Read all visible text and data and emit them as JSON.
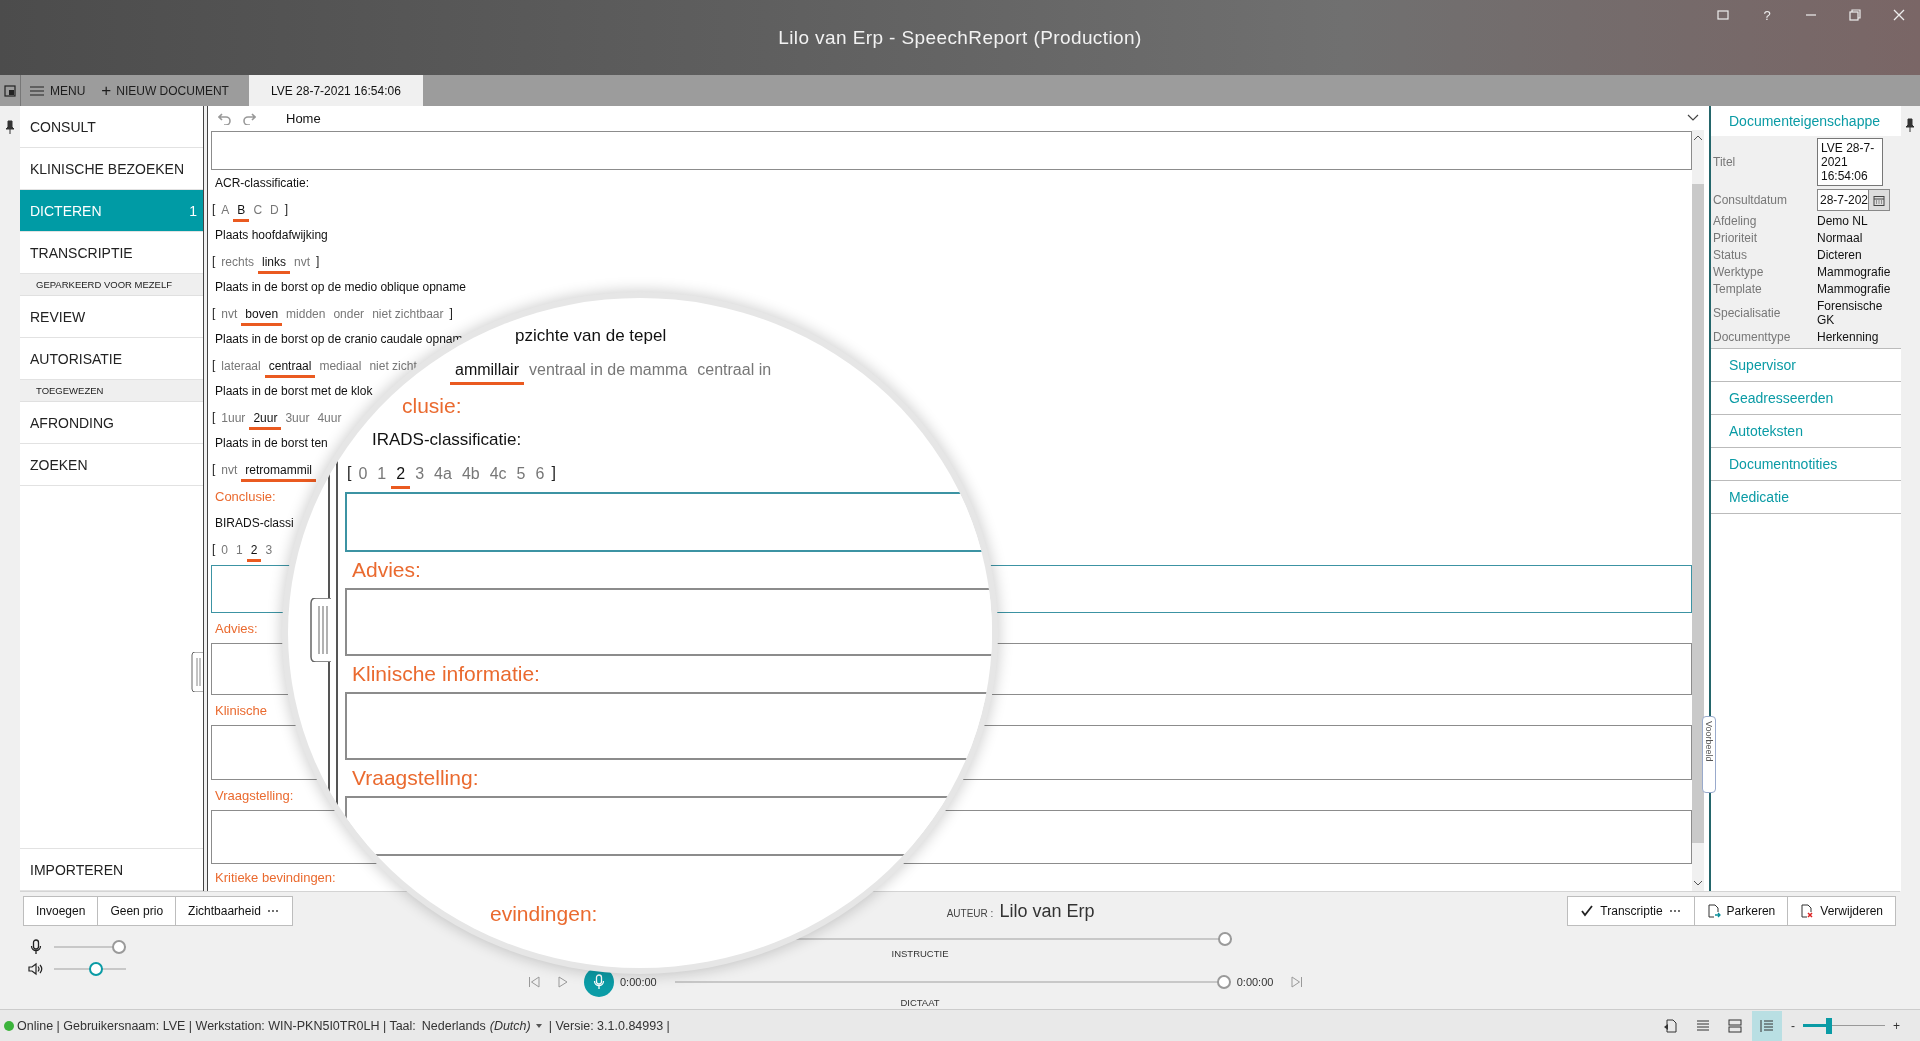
{
  "window": {
    "title": "Lilo van Erp - SpeechReport (Production)",
    "help_label": "?"
  },
  "tabbar": {
    "menu": "MENU",
    "new_document": "NIEUW DOCUMENT",
    "new_sign": "+",
    "tabs": [
      {
        "label": "LVE 28-7-2021 16:54:06",
        "selected": true
      }
    ]
  },
  "sidebar": {
    "items": [
      {
        "kind": "item",
        "label": "CONSULT",
        "selected": false
      },
      {
        "kind": "item",
        "label": "KLINISCHE BEZOEKEN",
        "selected": false
      },
      {
        "kind": "item",
        "label": "DICTEREN",
        "selected": true,
        "count": "1"
      },
      {
        "kind": "item",
        "label": "TRANSCRIPTIE",
        "selected": false
      },
      {
        "kind": "header",
        "label": "GEPARKEERD VOOR MEZELF"
      },
      {
        "kind": "item",
        "label": "REVIEW",
        "selected": false
      },
      {
        "kind": "item",
        "label": "AUTORISATIE",
        "selected": false
      },
      {
        "kind": "header",
        "label": "TOEGEWEZEN"
      },
      {
        "kind": "item",
        "label": "AFRONDING",
        "selected": false
      },
      {
        "kind": "item",
        "label": "ZOEKEN",
        "selected": false
      }
    ],
    "footer_items": [
      {
        "label": "IMPORTEREN",
        "selected": false
      }
    ]
  },
  "editor": {
    "toolbar": {
      "style": "Home"
    },
    "lines": [
      {
        "kind": "box",
        "focused": false
      },
      {
        "kind": "label",
        "text": "ACR-classificatie:"
      },
      {
        "kind": "options",
        "open": "[",
        "items": [
          {
            "label": "A",
            "selected": false
          },
          {
            "label": "B",
            "selected": true
          },
          {
            "label": "C",
            "selected": false
          },
          {
            "label": "D",
            "selected": false
          }
        ],
        "close": "]"
      },
      {
        "kind": "label",
        "text": "Plaats hoofdafwijking"
      },
      {
        "kind": "options",
        "open": "[",
        "items": [
          {
            "label": "rechts",
            "selected": false
          },
          {
            "label": "links",
            "selected": true
          },
          {
            "label": "nvt",
            "selected": false
          }
        ],
        "close": "]"
      },
      {
        "kind": "label",
        "text": "Plaats in de borst op de medio oblique opname"
      },
      {
        "kind": "options",
        "open": "[",
        "items": [
          {
            "label": "nvt",
            "selected": false
          },
          {
            "label": "boven",
            "selected": true
          },
          {
            "label": "midden",
            "selected": false
          },
          {
            "label": "onder",
            "selected": false
          },
          {
            "label": "niet zichtbaar",
            "selected": false
          }
        ],
        "close": "]"
      },
      {
        "kind": "label",
        "text": "Plaats in de borst op de cranio caudale opnam"
      },
      {
        "kind": "options",
        "open": "[",
        "items": [
          {
            "label": "lateraal",
            "selected": false
          },
          {
            "label": "centraal",
            "selected": true
          },
          {
            "label": "mediaal",
            "selected": false
          },
          {
            "label": "niet zicht",
            "selected": false
          }
        ]
      },
      {
        "kind": "label",
        "text": "Plaats in de borst met de klok"
      },
      {
        "kind": "options",
        "open": "[",
        "items": [
          {
            "label": "1uur",
            "selected": false
          },
          {
            "label": "2uur",
            "selected": true
          },
          {
            "label": "3uur",
            "selected": false
          },
          {
            "label": "4uur",
            "selected": false
          }
        ]
      },
      {
        "kind": "label",
        "text": "Plaats in de borst ten"
      },
      {
        "kind": "options",
        "open": "[",
        "items": [
          {
            "label": "nvt",
            "selected": false
          },
          {
            "label": "retromammil",
            "selected": true
          }
        ]
      },
      {
        "kind": "heading",
        "text": "Conclusie:"
      },
      {
        "kind": "label",
        "text": "BIRADS-classi"
      },
      {
        "kind": "options",
        "open": "[",
        "items": [
          {
            "label": "0",
            "selected": false
          },
          {
            "label": "1",
            "selected": false
          },
          {
            "label": "2",
            "selected": true
          },
          {
            "label": "3",
            "selected": false
          }
        ]
      },
      {
        "kind": "box",
        "focused": true
      },
      {
        "kind": "heading",
        "text": "Advies:"
      },
      {
        "kind": "box",
        "focused": false
      },
      {
        "kind": "heading",
        "text": "Klinische"
      },
      {
        "kind": "box",
        "focused": false
      },
      {
        "kind": "heading",
        "text": "Vraagstelling:"
      },
      {
        "kind": "box",
        "focused": false
      },
      {
        "kind": "heading",
        "text": "Kritieke bevindingen:"
      }
    ]
  },
  "magnifier": {
    "lines": [
      {
        "kind": "label",
        "text": "pzichte van de tepel"
      },
      {
        "kind": "options",
        "items": [
          {
            "label": "ammillair",
            "selected": true
          },
          {
            "label": "ventraal in de mamma",
            "selected": false
          },
          {
            "label": "centraal in",
            "selected": false
          }
        ]
      },
      {
        "kind": "heading",
        "text": "clusie:"
      },
      {
        "kind": "label",
        "text": "IRADS-classificatie:"
      },
      {
        "kind": "options",
        "open": "[",
        "items": [
          {
            "label": "0",
            "selected": false
          },
          {
            "label": "1",
            "selected": false
          },
          {
            "label": "2",
            "selected": true
          },
          {
            "label": "3",
            "selected": false
          },
          {
            "label": "4a",
            "selected": false
          },
          {
            "label": "4b",
            "selected": false
          },
          {
            "label": "4c",
            "selected": false
          },
          {
            "label": "5",
            "selected": false
          },
          {
            "label": "6",
            "selected": false
          }
        ],
        "close": "]"
      },
      {
        "kind": "box",
        "focused": true
      },
      {
        "kind": "heading",
        "text": "Advies:"
      },
      {
        "kind": "box",
        "focused": false
      },
      {
        "kind": "heading",
        "text": "Klinische informatie:"
      },
      {
        "kind": "box",
        "focused": false
      },
      {
        "kind": "heading",
        "text": "Vraagstelling:"
      },
      {
        "kind": "box",
        "focused": false
      },
      {
        "kind": "heading",
        "text": "evindingen:"
      }
    ]
  },
  "properties": {
    "title": "Documenteigenschappe",
    "preview_tab": "Voorbeeld",
    "rows": [
      {
        "kind": "textbox",
        "label": "Titel",
        "value": "LVE 28-7-2021 16:54:06"
      },
      {
        "kind": "date",
        "label": "Consultdatum",
        "value": "28-7-202"
      },
      {
        "kind": "text",
        "label": "Afdeling",
        "value": "Demo NL"
      },
      {
        "kind": "text",
        "label": "Prioriteit",
        "value": "Normaal"
      },
      {
        "kind": "text",
        "label": "Status",
        "value": "Dicteren"
      },
      {
        "kind": "text",
        "label": "Werktype",
        "value": "Mammografie"
      },
      {
        "kind": "text",
        "label": "Template",
        "value": "Mammografie"
      },
      {
        "kind": "text",
        "label": "Specialisatie",
        "value": "Forensische GK"
      },
      {
        "kind": "text",
        "label": "Documenttype",
        "value": "Herkenning"
      }
    ],
    "sections": [
      "Supervisor",
      "Geadresseerden",
      "Autoteksten",
      "Documentnotities",
      "Medicatie"
    ]
  },
  "bottom": {
    "left_buttons": [
      {
        "label": "Invoegen"
      },
      {
        "label": "Geen prio"
      },
      {
        "label": "Zichtbaarheid",
        "more": "⋯"
      }
    ],
    "author_label": "AUTEUR :",
    "author": "Lilo van Erp",
    "right_buttons": [
      {
        "kind": "transcribe",
        "label": "Transcriptie",
        "more": "⋯"
      },
      {
        "kind": "park",
        "label": "Parkeren"
      },
      {
        "kind": "delete",
        "label": "Verwijderen"
      }
    ],
    "mic_gain": {
      "level": 1
    },
    "volume": {
      "level": 0.6
    },
    "instructie": {
      "label": "INSTRUCTIE",
      "level": 1
    },
    "dictaat": {
      "label": "DICTAAT",
      "elapsed": "0:00:00",
      "total": "0:00:00",
      "level": 1
    }
  },
  "status_bar": {
    "online": true,
    "text": "Online | Gebruikersnaam: LVE | Werkstation: WIN-PKN5I0TR0LH | Taal:",
    "language": "Nederlands *(Dutch)*",
    "version": "| Versie: 3.1.0.84993 |",
    "view_modes": [
      {
        "selected": false
      },
      {
        "selected": false
      },
      {
        "selected": true
      }
    ],
    "zoom_minus": "-",
    "zoom_plus": "+",
    "zoom": {
      "level": 0.3
    }
  }
}
